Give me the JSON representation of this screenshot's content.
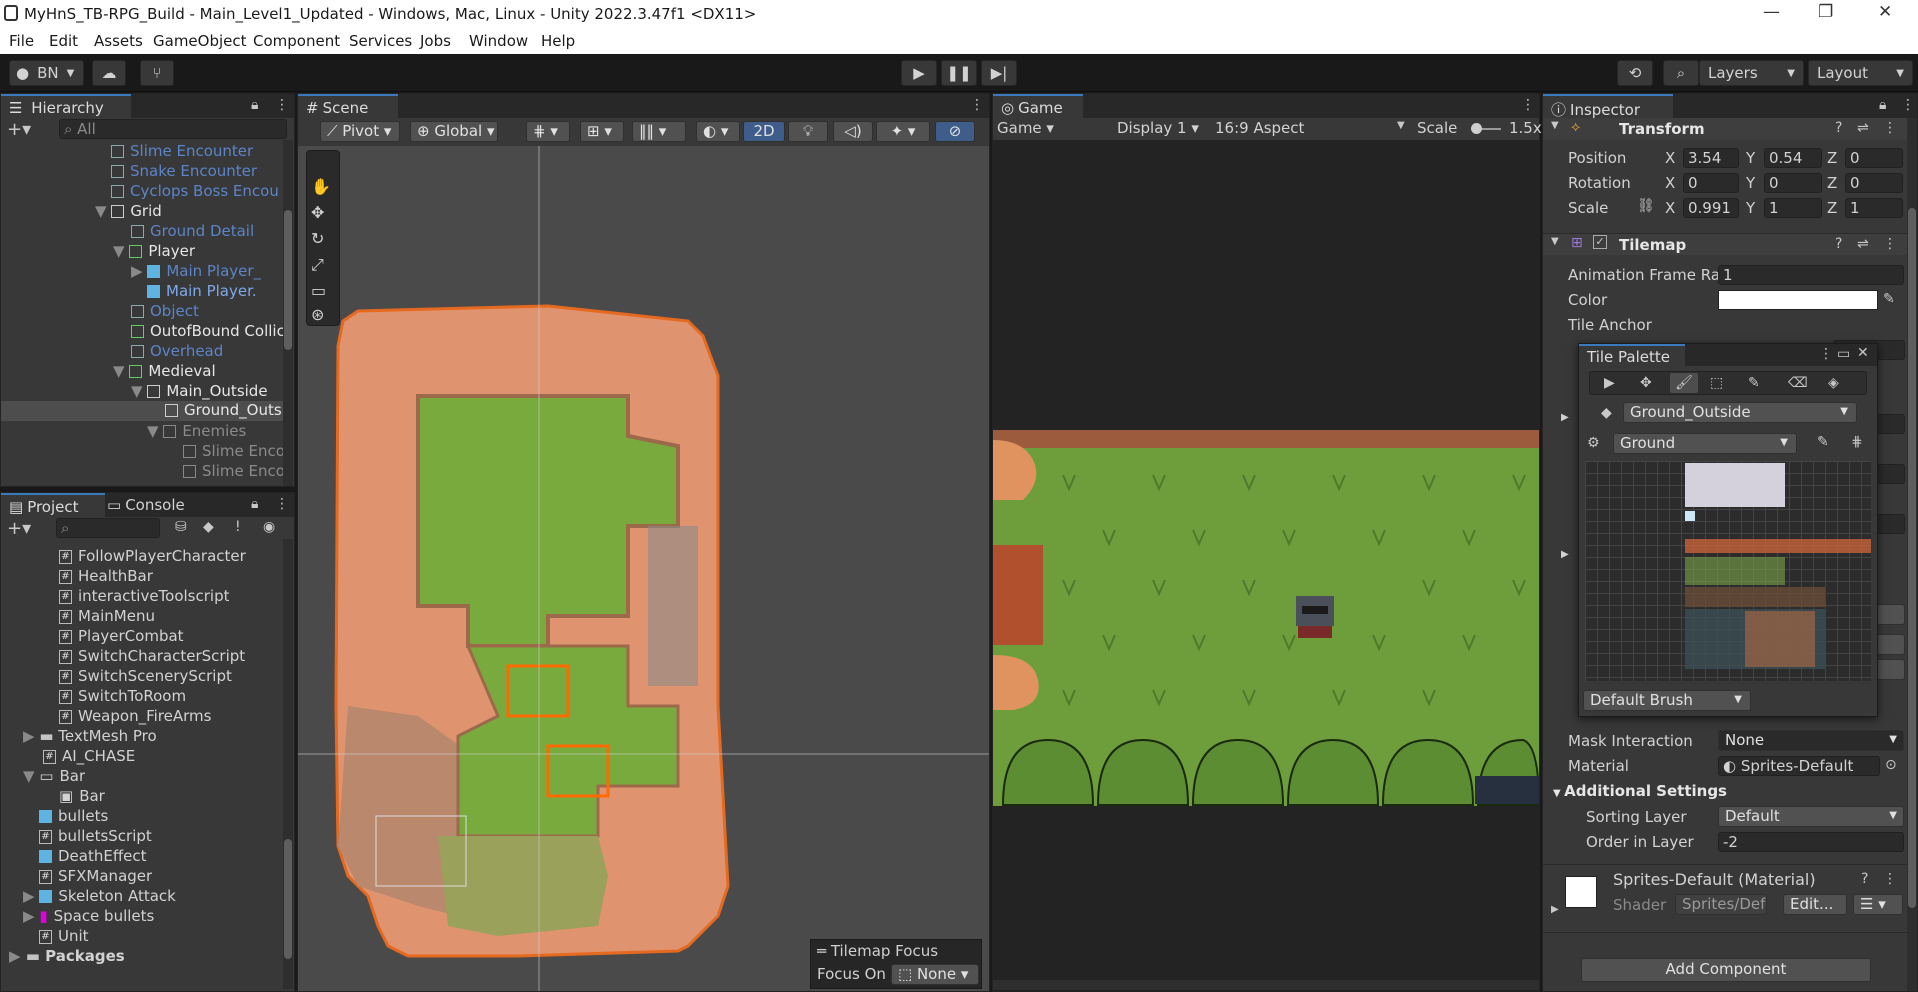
{
  "window": {
    "title": "MyHnS_TB-RPG_Build - Main_Level1_Updated - Windows, Mac, Linux - Unity 2022.3.47f1 <DX11>",
    "minimize": "—",
    "maximize": "❐",
    "close": "✕"
  },
  "menu": [
    "File",
    "Edit",
    "Assets",
    "GameObject",
    "Component",
    "Services",
    "Jobs",
    "Window",
    "Help"
  ],
  "toolbar": {
    "account": "BN",
    "layers": "Layers",
    "layout": "Layout"
  },
  "hierarchy": {
    "tab": "Hierarchy",
    "search_placeholder": "All",
    "items": [
      {
        "label": "Slime Encounter"
      },
      {
        "label": "Snake Encounter"
      },
      {
        "label": "Cyclops Boss Encou"
      },
      {
        "label": "Grid"
      },
      {
        "label": "Ground Detail"
      },
      {
        "label": "Player"
      },
      {
        "label": "Main Player_"
      },
      {
        "label": "Main Player."
      },
      {
        "label": "Object"
      },
      {
        "label": "OutofBound Collic"
      },
      {
        "label": "Overhead"
      },
      {
        "label": "Medieval"
      },
      {
        "label": "Main_Outside"
      },
      {
        "label": "Ground_Outs"
      },
      {
        "label": "Enemies"
      },
      {
        "label": "Slime Enco"
      },
      {
        "label": "Slime Enco"
      }
    ]
  },
  "project": {
    "tabs": [
      "Project",
      "Console"
    ],
    "items": [
      {
        "label": "FollowPlayerCharacter"
      },
      {
        "label": "HealthBar"
      },
      {
        "label": "interactiveToolscript"
      },
      {
        "label": "MainMenu"
      },
      {
        "label": "PlayerCombat"
      },
      {
        "label": "SwitchCharacterScript"
      },
      {
        "label": "SwitchSceneryScript"
      },
      {
        "label": "SwitchToRoom"
      },
      {
        "label": "Weapon_FireArms"
      },
      {
        "label": "TextMesh Pro"
      },
      {
        "label": "AI_CHASE"
      },
      {
        "label": "Bar"
      },
      {
        "label": "Bar"
      },
      {
        "label": "bullets"
      },
      {
        "label": "bulletsScript"
      },
      {
        "label": "DeathEffect"
      },
      {
        "label": "SFXManager"
      },
      {
        "label": "Skeleton Attack"
      },
      {
        "label": "Space bullets"
      },
      {
        "label": "Unit"
      },
      {
        "label": "Packages"
      }
    ]
  },
  "scene": {
    "tab": "Scene",
    "pivot": "Pivot",
    "global": "Global",
    "mode2d": "2D",
    "tilemap_focus": {
      "title": "Tilemap Focus",
      "label": "Focus On",
      "value": "None"
    }
  },
  "game": {
    "tab": "Game",
    "mode": "Game",
    "display": "Display 1",
    "aspect": "16:9 Aspect",
    "scale_label": "Scale",
    "scale_value": "1.5x"
  },
  "inspector": {
    "tab": "Inspector",
    "transform": {
      "title": "Transform",
      "position": {
        "label": "Position",
        "x": "3.54",
        "y": "0.54",
        "z": "0"
      },
      "rotation": {
        "label": "Rotation",
        "x": "0",
        "y": "0",
        "z": "0"
      },
      "scale": {
        "label": "Scale",
        "x": "0.991",
        "y": "1",
        "z": "1"
      }
    },
    "tilemap": {
      "title": "Tilemap",
      "anim_label": "Animation Frame Rat",
      "anim_value": "1",
      "color_label": "Color",
      "anchor_label": "Tile Anchor"
    },
    "renderer": {
      "mask_label": "Mask Interaction",
      "mask_value": "None",
      "material_label": "Material",
      "material_value": "Sprites-Default",
      "additional": "Additional Settings",
      "sorting_label": "Sorting Layer",
      "sorting_value": "Default",
      "order_label": "Order in Layer",
      "order_value": "-2"
    },
    "material": {
      "title": "Sprites-Default (Material)",
      "shader_label": "Shader",
      "shader_value": "Sprites/Def",
      "edit": "Edit..."
    },
    "add_component": "Add Component",
    "axis": {
      "x": "X",
      "y": "Y",
      "z": "Z"
    }
  },
  "tile_palette": {
    "title": "Tile Palette",
    "target": "Ground_Outside",
    "palette": "Ground",
    "brush": "Default Brush"
  },
  "colors": {
    "accent": "#3a79bb",
    "dirt": "#d9906f",
    "grass": "#6f9e3b",
    "panel": "#383838"
  }
}
